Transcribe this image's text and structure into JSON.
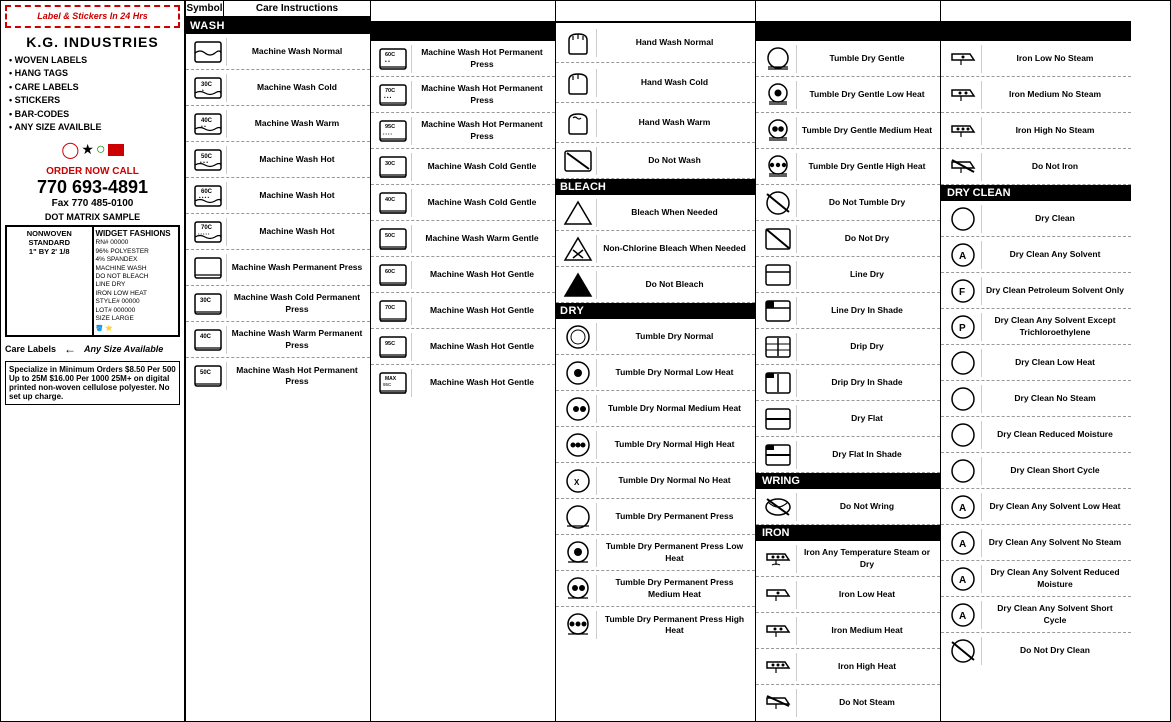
{
  "sidebar": {
    "logo_dashed": "Label & Stickers In 24 Hrs",
    "company": "K.G. INDUSTRIES",
    "bullets": [
      "WOVEN LABELS",
      "HANG TAGS",
      "CARE LABELS",
      "STICKERS",
      "BAR-CODES",
      "ANY SIZE AVAILBLE"
    ],
    "order_now": "ORDER NOW CALL",
    "phone": "770 693-4891",
    "fax": "Fax 770 485-0100",
    "dot_matrix": "DOT MATRIX SAMPLE",
    "nonwoven_title": "NONWOVEN STANDARD 1\" BY 2' 1/8",
    "widget_title": "WIDGET FASHIONS",
    "widget_body": "RN# 00000\n96% POLYESTER\n4% SPANDEX\nMACHINE WASH\nDO NOT BLEACH\nLINE DRY\nIRON LOW HEAT\nSTYLE# 00000\nLOT# 000000\nSIZE LARGE",
    "care_labels": "Care Labels",
    "any_size": "Any Size Available",
    "specialize": "Specialize in Minimum Orders $8.50 Per 500 Up to 25M $16.00 Per 1000 25M+ on digital printed non-woven cellulose polyester. No set up charge."
  },
  "wash_col": {
    "header_symbol": "Symbol",
    "header_care": "Care Instructions",
    "section": "WASH",
    "rows": [
      {
        "instruction": "Machine Wash Normal"
      },
      {
        "instruction": "Machine Wash Cold"
      },
      {
        "instruction": "Machine Wash Warm"
      },
      {
        "instruction": "Machine Wash Hot"
      },
      {
        "instruction": "Machine Wash Hot"
      },
      {
        "instruction": "Machine Wash Hot"
      },
      {
        "instruction": "Machine Wash Permanent Press"
      },
      {
        "instruction": "Machine Wash Cold Permanent Press"
      },
      {
        "instruction": "Machine Wash Warm Permanent Press"
      },
      {
        "instruction": "Machine Wash Hot Permanent Press"
      }
    ]
  },
  "pp_col": {
    "rows": [
      {
        "instruction": "Machine Wash Hot Permanent Press"
      },
      {
        "instruction": "Machine Wash Hot Permanent Press"
      },
      {
        "instruction": "Machine Wash Hot Permanent Press"
      },
      {
        "instruction": "Machine Wash Cold Gentle"
      },
      {
        "instruction": "Machine Wash Cold Gentle"
      },
      {
        "instruction": "Machine Wash Warm Gentle"
      },
      {
        "instruction": "Machine Wash Hot Gentle"
      },
      {
        "instruction": "Machine Wash Hot Gentle"
      },
      {
        "instruction": "Machine Wash Hot Gentle"
      },
      {
        "instruction": "Machine Wash Hot Gentle"
      }
    ]
  },
  "dry_col": {
    "section": "DRY",
    "hand_wash_rows": [
      {
        "instruction": "Hand Wash Normal"
      },
      {
        "instruction": "Hand Wash Cold"
      },
      {
        "instruction": "Hand Wash Warm"
      },
      {
        "instruction": "Do Not Wash"
      }
    ],
    "bleach_section": "BLEACH",
    "bleach_rows": [
      {
        "instruction": "Bleach When Needed"
      },
      {
        "instruction": "Non-Chlorine Bleach When Needed"
      },
      {
        "instruction": "Do Not Bleach"
      }
    ],
    "dry_rows": [
      {
        "instruction": "Tumble Dry Normal"
      },
      {
        "instruction": "Tumble Dry Normal Low Heat"
      },
      {
        "instruction": "Tumble Dry Normal Medium Heat"
      },
      {
        "instruction": "Tumble Dry Normal High Heat"
      },
      {
        "instruction": "Tumble Dry Normal No Heat"
      },
      {
        "instruction": "Tumble Dry Permanent Press"
      },
      {
        "instruction": "Tumble Dry Permanent Press Low Heat"
      },
      {
        "instruction": "Tumble Dry Permanent Press Medium Heat"
      },
      {
        "instruction": "Tumble Dry Permanent Press High Heat"
      }
    ]
  },
  "drip_col": {
    "tumble_rows": [
      {
        "instruction": "Tumble Dry Gentle"
      },
      {
        "instruction": "Tumble Dry Gentle Low Heat"
      },
      {
        "instruction": "Tumble Dry Gentle Medium Heat"
      },
      {
        "instruction": "Tumble Dry Gentle High Heat"
      },
      {
        "instruction": "Do Not Tumble Dry"
      },
      {
        "instruction": "Do Not Dry"
      },
      {
        "instruction": "Line Dry"
      },
      {
        "instruction": "Line Dry In Shade"
      },
      {
        "instruction": "Drip Dry"
      },
      {
        "instruction": "Drip Dry In Shade"
      },
      {
        "instruction": "Dry Flat"
      },
      {
        "instruction": "Dry Flat In Shade"
      }
    ],
    "wring_section": "WRING",
    "wring_rows": [
      {
        "instruction": "Do Not Wring"
      }
    ],
    "iron_section": "IRON",
    "iron_rows": [
      {
        "instruction": "Iron Any Temperature Steam or Dry"
      },
      {
        "instruction": "Iron Low Heat"
      },
      {
        "instruction": "Iron Medium Heat"
      },
      {
        "instruction": "Iron High Heat"
      },
      {
        "instruction": "Do Not Steam"
      }
    ]
  },
  "iron_col": {
    "dry_clean_section": "DRY CLEAN",
    "rows": [
      {
        "instruction": "Iron Low No Steam"
      },
      {
        "instruction": "Iron Medium No Steam"
      },
      {
        "instruction": "Iron High No Steam"
      },
      {
        "instruction": "Do Not Iron"
      },
      {
        "instruction": "Dry Clean"
      },
      {
        "instruction": "Dry Clean Any Solvent"
      },
      {
        "instruction": "Dry Clean Petroleum Solvent Only"
      },
      {
        "instruction": "Dry Clean Any Solvent Except Trichloroethylene"
      },
      {
        "instruction": "Dry Clean Low Heat"
      },
      {
        "instruction": "Dry Clean No Steam"
      },
      {
        "instruction": "Dry Clean Reduced Moisture"
      },
      {
        "instruction": "Dry Clean Short Cycle"
      },
      {
        "instruction": "Dry Clean Any Solvent Low Heat"
      },
      {
        "instruction": "Dry Clean Any Solvent No Steam"
      },
      {
        "instruction": "Dry Clean Any Solvent Reduced Moisture"
      },
      {
        "instruction": "Dry Clean Any Solvent Short Cycle"
      },
      {
        "instruction": "Do Not Dry Clean"
      }
    ]
  }
}
